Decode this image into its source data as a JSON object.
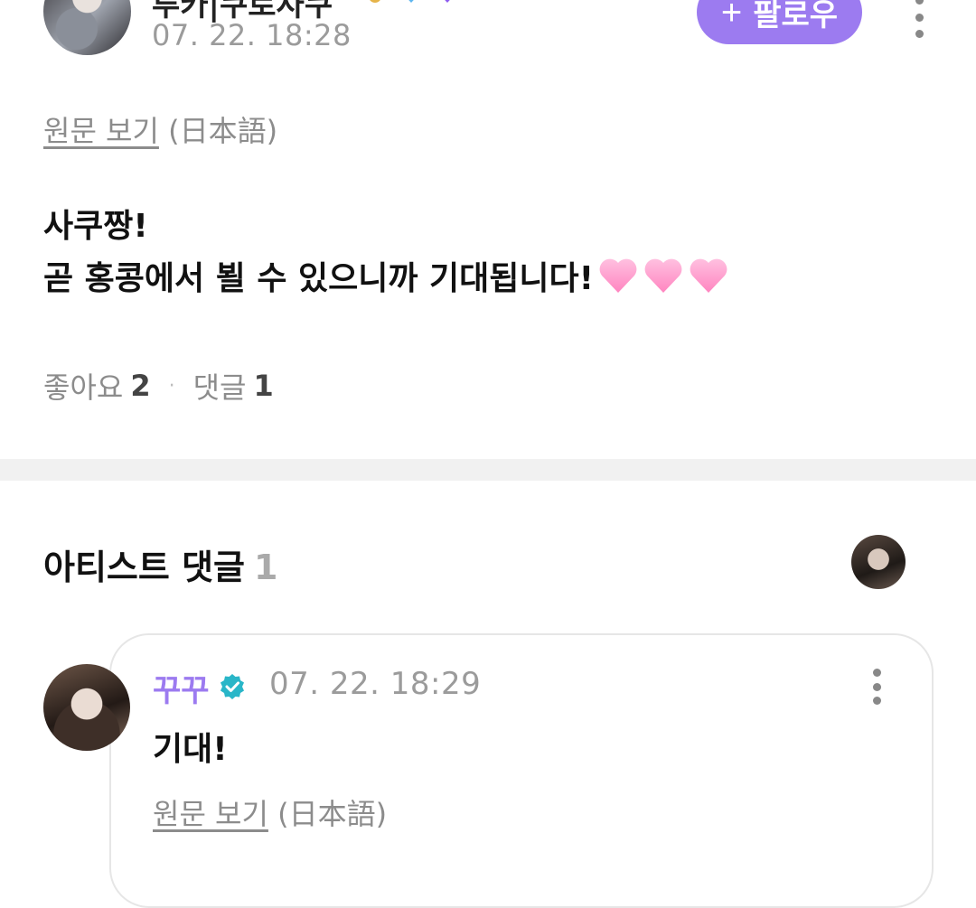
{
  "post": {
    "author_name": "루카|쿠로사쿠",
    "time": "07. 22. 18:28",
    "follow_label": "팔로우",
    "follow_icon": "+",
    "original_link": "원문 보기",
    "original_lang": "(日本語)",
    "line1": "사쿠짱!",
    "line2": "곧 홍콩에서 뵐 수 있으니까 기대됩니다!",
    "hearts": [
      "pink-heart-icon",
      "pink-heart-icon",
      "pink-heart-icon"
    ],
    "likes_label": "좋아요",
    "likes_count": "2",
    "separator": "·",
    "comments_label": "댓글",
    "comments_count": "1"
  },
  "artist_comments": {
    "title": "아티스트 댓글",
    "count": "1",
    "comment": {
      "name": "꾸꾸",
      "time": "07. 22. 18:29",
      "text": "기대!",
      "original_link": "원문 보기",
      "original_lang": "(日本語)"
    }
  },
  "colors": {
    "accent": "#9c7bf0",
    "verified": "#29b6c8",
    "heart": "#ff9fcf",
    "muted": "#8c8c8c"
  }
}
